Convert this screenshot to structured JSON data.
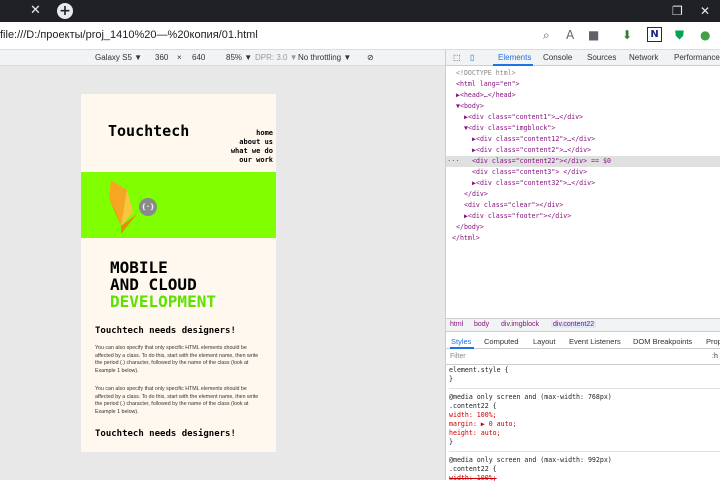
{
  "browser": {
    "url": "file:///D:/проекты/proj_1410%20—%20копия/01.html"
  },
  "device_toolbar": {
    "device": "Galaxy S5 ▼",
    "width": "360",
    "times": "×",
    "height": "640",
    "zoom": "85% ▼",
    "dpr": "DPR: 3.0 ▼",
    "throttle": "No throttling ▼"
  },
  "page": {
    "logo": "Touchtech",
    "nav": [
      "home",
      "about us",
      "what we do",
      "our work"
    ],
    "hero_line1": "MOBILE",
    "hero_line2": "AND CLOUD",
    "hero_line3": "DEVELOPMENT",
    "heading1": "Touchtech needs designers!",
    "para1": "You can also specify that only specific HTML elements should be affected by a class. To do this, start with the element name, then write the period (.) character, followed by the name of the class (look at Example 1 below).",
    "para2": "You can also specify that only specific HTML elements should be affected by a class. To do this, start with the element name, then write the period (.) character, followed by the name of the class (look at Example 1 below).",
    "heading2": "Touchtech needs designers!"
  },
  "devtools": {
    "tabs": [
      "Elements",
      "Console",
      "Sources",
      "Network",
      "Performance"
    ],
    "dom_lines": [
      {
        "indent": 10,
        "text": "<!DOCTYPE html>"
      },
      {
        "indent": 10,
        "text": "<html lang=\"en\">"
      },
      {
        "indent": 10,
        "text": "▶<head>…</head>"
      },
      {
        "indent": 10,
        "text": "▼<body>"
      },
      {
        "indent": 18,
        "text": "▶<div class=\"content1\">…</div>"
      },
      {
        "indent": 18,
        "text": "▼<div class=\"imgblock\">"
      },
      {
        "indent": 26,
        "text": "▶<div class=\"content12\">…</div>"
      },
      {
        "indent": 26,
        "text": "▶<div class=\"content2\">…</div>"
      },
      {
        "indent": 26,
        "text": "<div class=\"content22\"></div> == $0"
      },
      {
        "indent": 26,
        "text": "<div class=\"content3\"> </div>"
      },
      {
        "indent": 26,
        "text": "▶<div class=\"content32\">…</div>"
      },
      {
        "indent": 18,
        "text": "</div>"
      },
      {
        "indent": 18,
        "text": "<div class=\"clear\"></div>"
      },
      {
        "indent": 18,
        "text": "▶<div class=\"footer\"></div>"
      },
      {
        "indent": 10,
        "text": "</body>"
      },
      {
        "indent": 6,
        "text": "</html>"
      }
    ],
    "selected_line_marker": "···",
    "breadcrumb": [
      "html",
      "body",
      "div.imgblock",
      "div.content22"
    ],
    "styles_tabs": [
      "Styles",
      "Computed",
      "Layout",
      "Event Listeners",
      "DOM Breakpoints",
      "Prop"
    ],
    "filter_placeholder": "Filter",
    "filter_right": ":h",
    "css_lines": [
      "element.style {",
      "}",
      "@media only screen and (max-width: 768px)",
      ".content22 {",
      "  width: 100%;",
      "  margin: ▶ 0 auto;",
      "  height: auto;",
      "}",
      "@media only screen and (max-width: 992px)",
      ".content22 {",
      "  width: 100%;"
    ]
  },
  "colors": {
    "green_block": "#80ff00",
    "dev_text": "#5ee000",
    "page_bg": "#fff8ee"
  }
}
